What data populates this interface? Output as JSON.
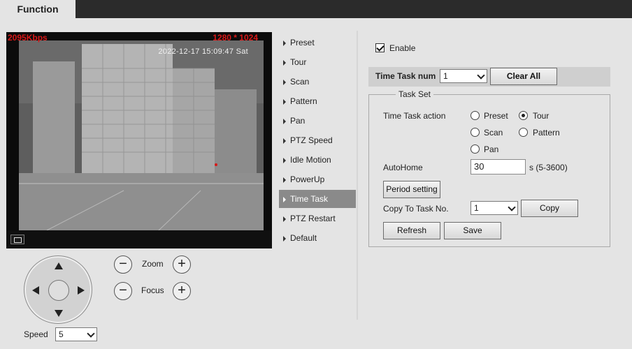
{
  "header": {
    "tab_label": "Function"
  },
  "video": {
    "bitrate": "2095Kbps",
    "resolution": "1280 * 1024",
    "osd_time": "2022-12-17 15:09:47 Sat"
  },
  "ptz_controls": {
    "zoom_label": "Zoom",
    "focus_label": "Focus",
    "minus_glyph": "−",
    "plus_glyph": "+",
    "speed_label": "Speed",
    "speed_value": "5"
  },
  "menu": {
    "items": [
      {
        "label": "Preset"
      },
      {
        "label": "Tour"
      },
      {
        "label": "Scan"
      },
      {
        "label": "Pattern"
      },
      {
        "label": "Pan"
      },
      {
        "label": "PTZ Speed"
      },
      {
        "label": "Idle Motion"
      },
      {
        "label": "PowerUp"
      },
      {
        "label": "Time Task"
      },
      {
        "label": "PTZ Restart"
      },
      {
        "label": "Default"
      }
    ],
    "active_index": 8
  },
  "time_task": {
    "enable_label": "Enable",
    "enable_checked": true,
    "task_num_label": "Time Task num",
    "task_num_value": "1",
    "clear_all_label": "Clear All",
    "task_set_legend": "Task Set",
    "action_label": "Time Task action",
    "actions": [
      {
        "label": "Preset",
        "selected": false
      },
      {
        "label": "Tour",
        "selected": true
      },
      {
        "label": "Scan",
        "selected": false
      },
      {
        "label": "Pattern",
        "selected": false
      },
      {
        "label": "Pan",
        "selected": false
      }
    ],
    "autohome_label": "AutoHome",
    "autohome_value": "30",
    "autohome_unit": "s (5-3600)",
    "period_setting_label": "Period setting",
    "copy_to_label": "Copy To Task No.",
    "copy_to_value": "1",
    "copy_label": "Copy",
    "refresh_label": "Refresh",
    "save_label": "Save"
  },
  "colors": {
    "active_menu_bg": "#8a8a8a",
    "topbar_bg": "#2b2b2b",
    "osd_red": "#d81818"
  }
}
